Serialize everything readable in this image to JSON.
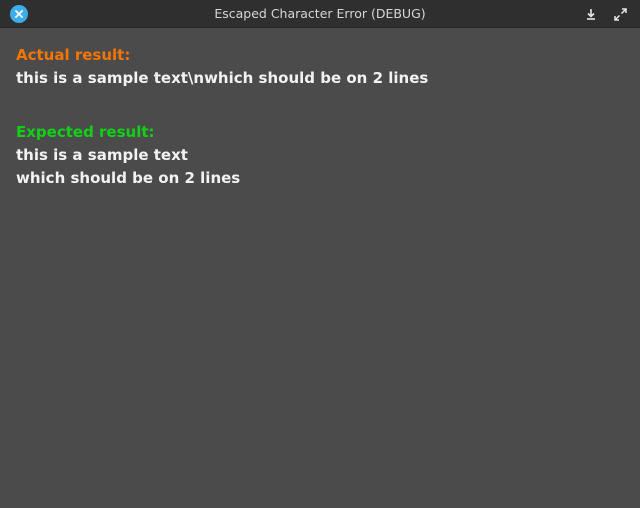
{
  "window": {
    "title": "Escaped Character Error (DEBUG)"
  },
  "actual": {
    "label": "Actual result:",
    "line1": "this is a sample text\\nwhich should be on 2 lines"
  },
  "expected": {
    "label": "Expected result:",
    "line1": "this is a sample text",
    "line2": "which should be on 2 lines"
  },
  "colors": {
    "actual_label": "#f67400",
    "expected_label": "#11d116",
    "close_button": "#3daee9"
  }
}
